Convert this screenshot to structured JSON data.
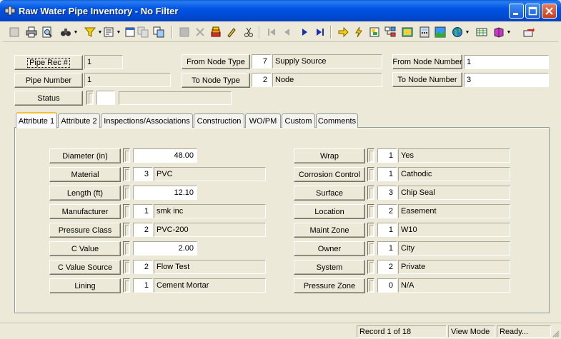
{
  "window": {
    "title": "Raw Water Pipe Inventory - No Filter"
  },
  "header": {
    "pipe_rec_label": "Pipe Rec #",
    "pipe_rec_value": "1",
    "pipe_number_label": "Pipe Number",
    "pipe_number_value": "1",
    "status_label": "Status",
    "status_code": "",
    "status_desc": "",
    "from_node_type_label": "From Node Type",
    "from_node_type_code": "7",
    "from_node_type_desc": "Supply Source",
    "to_node_type_label": "To Node Type",
    "to_node_type_code": "2",
    "to_node_type_desc": "Node",
    "from_node_number_label": "From Node Number",
    "from_node_number_value": "1",
    "to_node_number_label": "To Node Number",
    "to_node_number_value": "3"
  },
  "tabs": [
    "Attribute 1",
    "Attribute 2",
    "Inspections/Associations",
    "Construction",
    "WO/PM",
    "Custom",
    "Comments"
  ],
  "attributes_left": [
    {
      "label": "Diameter (in)",
      "code": "",
      "value": "48.00"
    },
    {
      "label": "Material",
      "code": "3",
      "value": "PVC"
    },
    {
      "label": "Length (ft)",
      "code": "",
      "value": "12.10"
    },
    {
      "label": "Manufacturer",
      "code": "1",
      "value": "smk inc"
    },
    {
      "label": "Pressure Class",
      "code": "2",
      "value": "PVC-200"
    },
    {
      "label": "C Value",
      "code": "",
      "value": "2.00"
    },
    {
      "label": "C Value Source",
      "code": "2",
      "value": "Flow Test"
    },
    {
      "label": "Lining",
      "code": "1",
      "value": "Cement Mortar"
    }
  ],
  "attributes_right": [
    {
      "label": "Wrap",
      "code": "1",
      "value": "Yes"
    },
    {
      "label": "Corrosion Control",
      "code": "1",
      "value": "Cathodic"
    },
    {
      "label": "Surface",
      "code": "3",
      "value": "Chip Seal"
    },
    {
      "label": "Location",
      "code": "2",
      "value": "Easement"
    },
    {
      "label": "Maint Zone",
      "code": "1",
      "value": "W10"
    },
    {
      "label": "Owner",
      "code": "1",
      "value": "City"
    },
    {
      "label": "System",
      "code": "2",
      "value": "Private"
    },
    {
      "label": "Pressure Zone",
      "code": "0",
      "value": "N/A"
    }
  ],
  "statusbar": {
    "record": "Record 1 of 18",
    "mode": "View Mode",
    "state": "Ready..."
  },
  "toolbar_icons": [
    "new-icon",
    "print-icon",
    "print-preview-icon",
    "binoculars-icon",
    "filter-icon",
    "form-icon",
    "window-icon",
    "copy-record-icon",
    "save-icon",
    "delete-icon",
    "edit-icon",
    "pencil-icon",
    "scissors-icon",
    "first-record-icon",
    "prev-record-icon",
    "next-record-icon",
    "last-record-icon",
    "goto-icon",
    "lightning-icon",
    "report-icon",
    "tree-icon",
    "map-icon",
    "calculator-icon",
    "image-icon",
    "globe-icon",
    "spreadsheet-icon",
    "book-icon",
    "exit-icon"
  ]
}
